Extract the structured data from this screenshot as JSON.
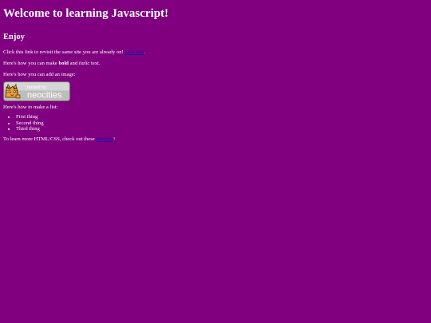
{
  "heading": "Welcome to learning Javascript!",
  "subheading": "Enjoy",
  "link_para": {
    "prefix": "Click this link to revisit the same site you are already on! ",
    "link_text": "click this",
    "suffix": "."
  },
  "format_para": {
    "prefix": "Here's how you can make ",
    "bold": "bold",
    "middle": " and ",
    "italic": "italic",
    "suffix": " text."
  },
  "image_para": "Here's how you can add an image:",
  "badge": {
    "line1": "hosted by",
    "line2": "neocities"
  },
  "list_para": "Here's how to make a list:",
  "list_items": [
    "First thing",
    "Second thing",
    "Third thing"
  ],
  "learn_para": {
    "prefix": "To learn more HTML/CSS, check out these ",
    "link_text": "tutorials",
    "suffix": "!"
  },
  "colors": {
    "background": "#800080",
    "text": "#ffffff",
    "link": "#1a0dab"
  }
}
